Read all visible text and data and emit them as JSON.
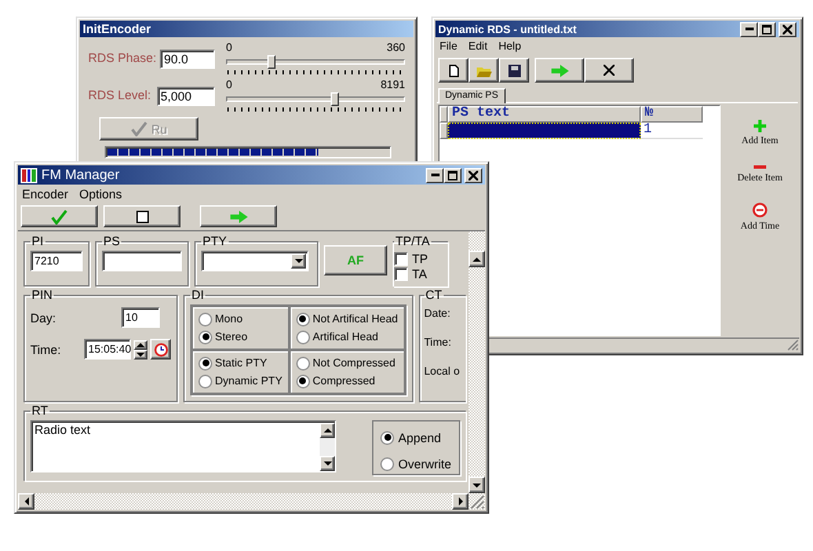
{
  "init_encoder": {
    "title": "InitEncoder",
    "fields": [
      {
        "label": "RDS Phase:",
        "value": "90.0",
        "scale_min": "0",
        "scale_max": "360",
        "level": 0.25
      },
      {
        "label": "RDS Level:",
        "value": "5,000",
        "scale_min": "0",
        "scale_max": "8191",
        "level": 0.61
      }
    ],
    "run_button": {
      "label": "Ru",
      "disabled": true
    },
    "progress": {
      "level": 0.75
    }
  },
  "dynamic_rds": {
    "title": "Dynamic RDS - untitled.txt",
    "menu": [
      "File",
      "Edit",
      "Help"
    ],
    "tabs": [
      {
        "label": "Dynamic PS",
        "selected": true
      }
    ],
    "columns": [
      "PS text",
      "№"
    ],
    "rows": [
      {
        "number": "1",
        "selected": true
      }
    ],
    "actions": [
      {
        "kind": "add",
        "label": "Add Item"
      },
      {
        "kind": "delete",
        "label": "Delete Item"
      },
      {
        "kind": "time",
        "label": "Add Time"
      }
    ]
  },
  "fm_manager": {
    "title": "FM Manager",
    "menu": [
      "Encoder",
      "Options"
    ],
    "pi": {
      "label": "PI",
      "value": "7210"
    },
    "ps": {
      "label": "PS"
    },
    "pty": {
      "label": "PTY"
    },
    "af_button": "AF",
    "tpta": {
      "label": "TP/TA",
      "options": [
        {
          "label": "TP",
          "checked": false
        },
        {
          "label": "TA",
          "checked": false
        }
      ]
    },
    "pin": {
      "label": "PIN",
      "day_label": "Day:",
      "day": "10",
      "time_label": "Time:",
      "time": "15:05:40"
    },
    "di": {
      "label": "DI",
      "groups": [
        {
          "options": [
            {
              "label": "Mono",
              "selected": false
            },
            {
              "label": "Stereo",
              "selected": true
            }
          ]
        },
        {
          "options": [
            {
              "label": "Not Artifical Head",
              "selected": true
            },
            {
              "label": "Artifical Head",
              "selected": false
            }
          ]
        },
        {
          "options": [
            {
              "label": "Static PTY",
              "selected": true
            },
            {
              "label": "Dynamic PTY",
              "selected": false
            }
          ]
        },
        {
          "options": [
            {
              "label": "Not Compressed",
              "selected": false
            },
            {
              "label": "Compressed",
              "selected": true
            }
          ]
        }
      ]
    },
    "ct": {
      "label": "CT",
      "rows": [
        "Date:",
        "Time:",
        "Local o"
      ]
    },
    "rt": {
      "label": "RT",
      "text": "Radio text",
      "modes": [
        {
          "label": "Append",
          "selected": true
        },
        {
          "label": "Overwrite",
          "selected": false
        }
      ]
    }
  }
}
